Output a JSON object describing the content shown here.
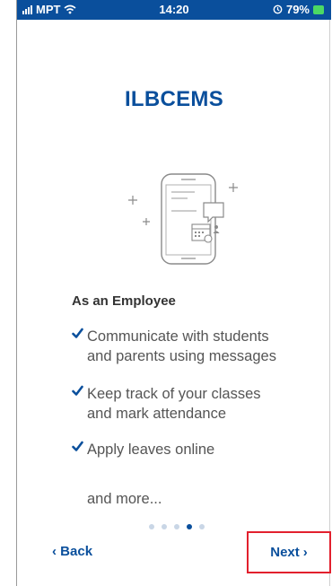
{
  "status_bar": {
    "carrier": "MPT",
    "time": "14:20",
    "battery": "79%"
  },
  "app_title": "ILBCEMS",
  "onboarding": {
    "section_heading": "As an Employee",
    "features": [
      {
        "line1": "Communicate with students",
        "line2": "and parents using messages"
      },
      {
        "line1": "Keep track of your classes",
        "line2": "and mark attendance"
      },
      {
        "line1": "Apply leaves online",
        "line2": ""
      }
    ],
    "more_text": "and more...",
    "page_indicator": {
      "total": 5,
      "current": 4
    }
  },
  "nav": {
    "back_label": "Back",
    "next_label": "Next"
  },
  "colors": {
    "brand": "#0a4f9c",
    "status_bar": "#0a4f9c",
    "highlight_border": "#e2202d"
  },
  "icons": [
    "signal-icon",
    "wifi-icon",
    "alarm-icon",
    "battery-icon",
    "phone-illustration",
    "checkmark-icon",
    "chevron-left-icon",
    "chevron-right-icon"
  ]
}
